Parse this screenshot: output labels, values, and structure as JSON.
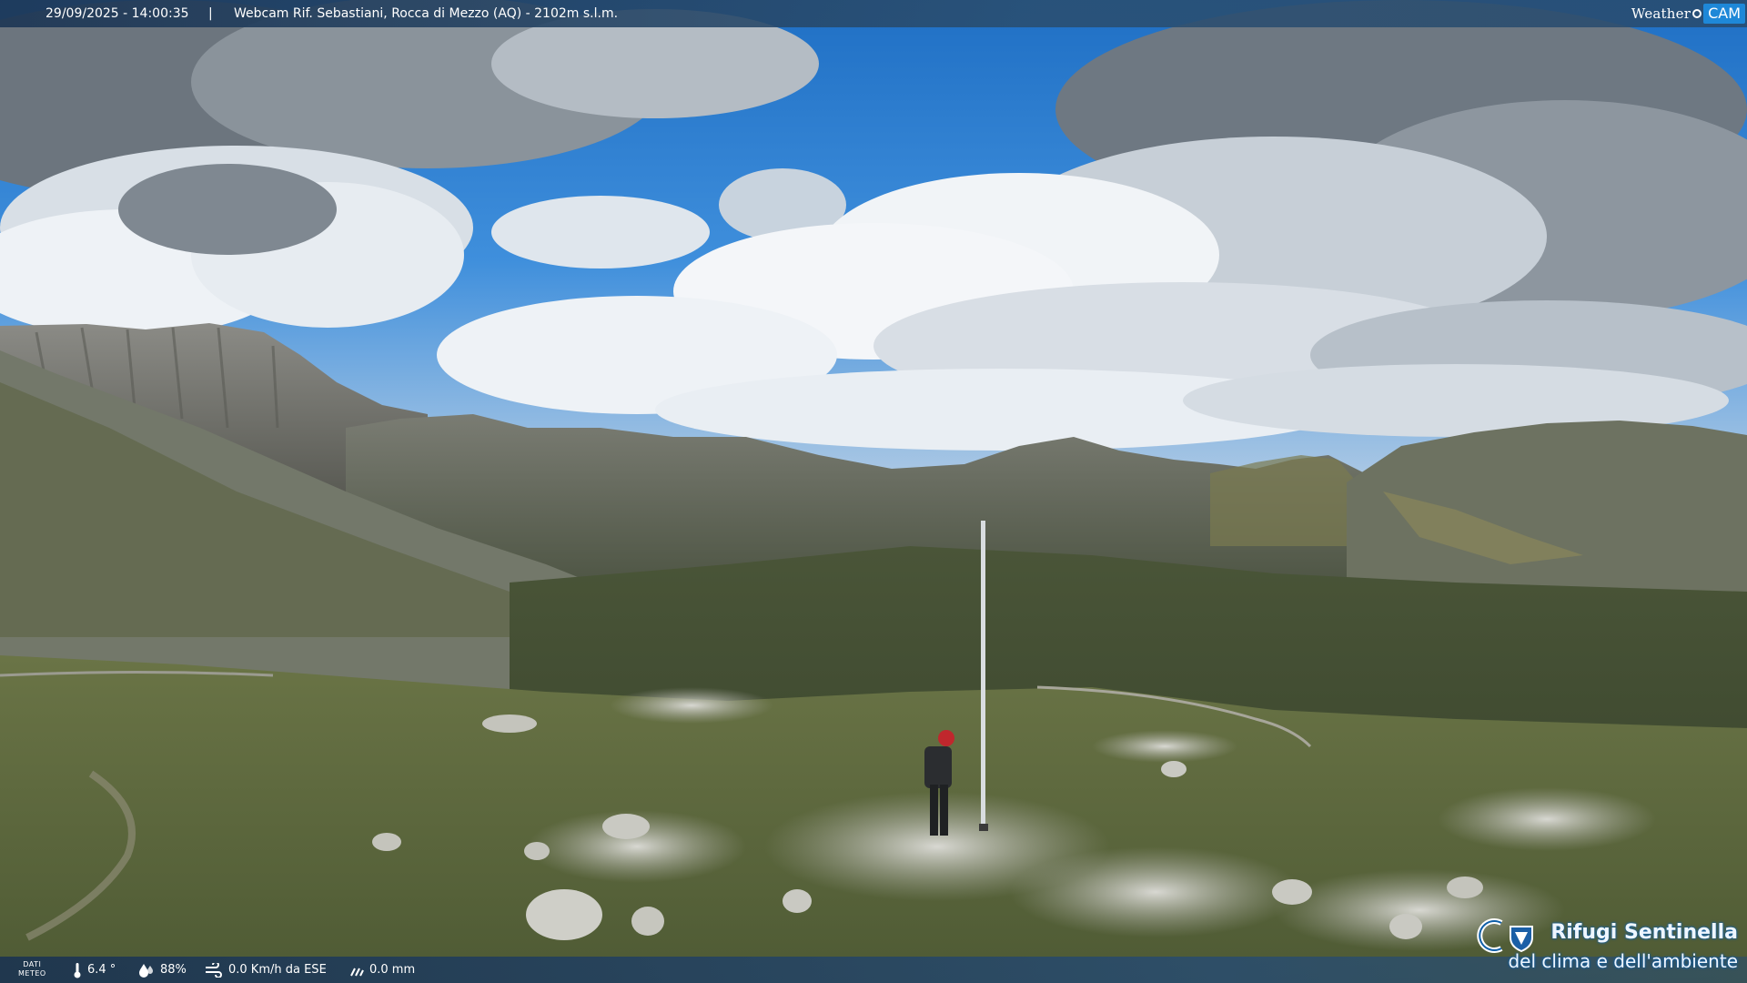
{
  "overlay": {
    "timestamp": "29/09/2025 - 14:00:35",
    "separator": "|",
    "title": "Webcam Rif. Sebastiani, Rocca di Mezzo (AQ) - 2102m s.l.m.",
    "brand_weather": "Weather",
    "brand_cam": "CAM"
  },
  "weather": {
    "label_line1": "DATI",
    "label_line2": "METEO",
    "temperature": "6.4 °",
    "humidity": "88%",
    "wind": "0.0 Km/h da ESE",
    "rain": "0.0 mm"
  },
  "logo": {
    "line1": "Rifugi Sentinella",
    "line2": "del clima e dell'ambiente"
  },
  "colors": {
    "sky_top": "#2a7bd0",
    "sky_horizon": "#8fb7de",
    "cloud_light": "#eef2f6",
    "cloud_dark": "#59636d",
    "cliff": "#6e6e6a",
    "grass": "#5b6a3f",
    "rock": "#bdbdb6",
    "bar": "#244a72",
    "brand_blue": "#1e88d8"
  }
}
